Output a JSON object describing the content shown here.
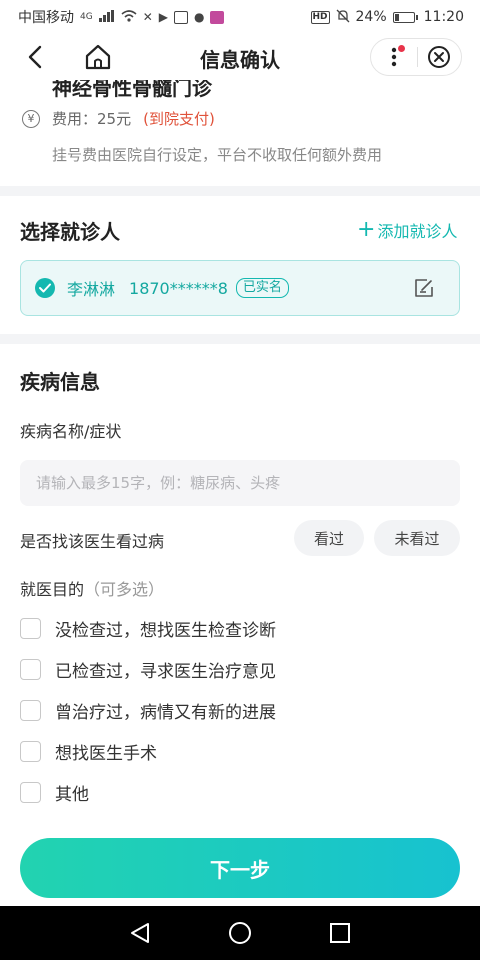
{
  "status_bar": {
    "carrier": "中国移动",
    "network": "4G",
    "hd": "HD",
    "battery": "24%",
    "battery_level": 0.24,
    "time": "11:20"
  },
  "nav": {
    "title": "信息确认"
  },
  "fee_section": {
    "clinic_name": "神经骨性骨髓门诊",
    "fee_icon": "¥",
    "fee_label": "费用：25元",
    "pay_method": "(到院支付)",
    "note": "挂号费由医院自行设定，平台不收取任何额外费用"
  },
  "patient_section": {
    "title": "选择就诊人",
    "add_label": "添加就诊人",
    "patient": {
      "name": "李淋淋",
      "phone": "1870******8",
      "badge": "已实名"
    }
  },
  "disease_section": {
    "title": "疾病信息",
    "name_label": "疾病名称/症状",
    "input_placeholder": "请输入最多15字，例：糖尿病、头疼",
    "input_value": "",
    "visited_question": "是否找该医生看过病",
    "visited_options": [
      "看过",
      "未看过"
    ],
    "purpose_label": "就医目的",
    "purpose_hint": "（可多选）",
    "purposes": [
      "没检查过，想找医生检查诊断",
      "已检查过，寻求医生治疗意见",
      "曾治疗过，病情又有新的进展",
      "想找医生手术",
      "其他"
    ]
  },
  "footer": {
    "next_label": "下一步"
  },
  "colors": {
    "accent": "#14b8b0",
    "pay_red": "#e0523a",
    "button_gradient_start": "#22d3b0",
    "button_gradient_end": "#17c2d0"
  }
}
